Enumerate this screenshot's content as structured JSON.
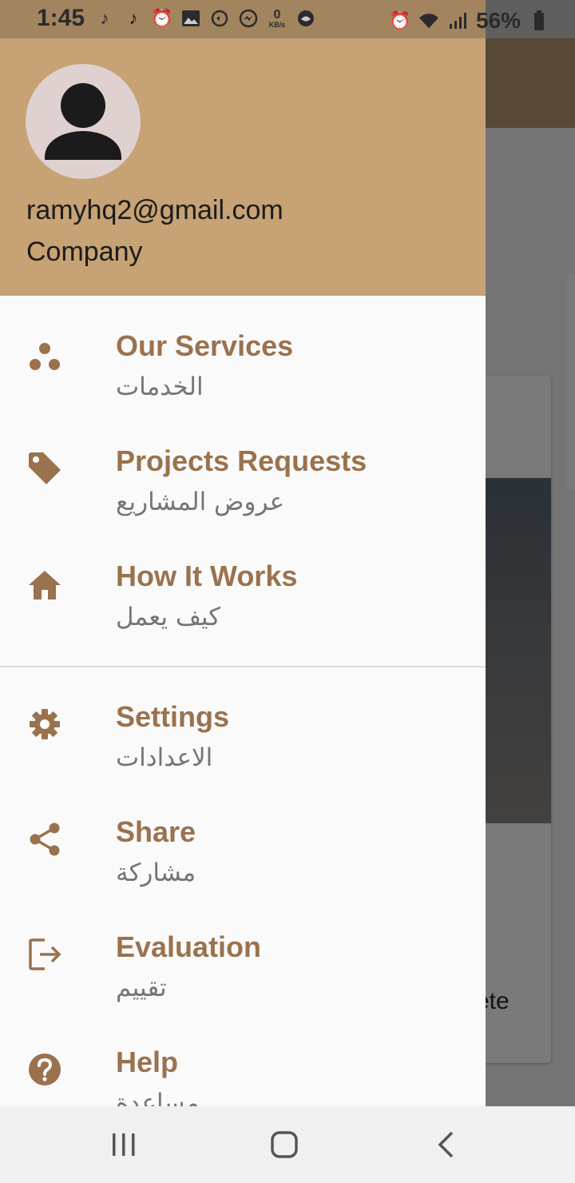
{
  "status_bar": {
    "time": "1:45",
    "network_speed_value": "0",
    "network_speed_unit": "KB/s",
    "battery": "56%"
  },
  "background_app": {
    "visible_text": "ete"
  },
  "drawer": {
    "header": {
      "email": "ramyhq2@gmail.com",
      "account_type": "Company"
    },
    "items": [
      {
        "icon": "services-icon",
        "title": "Our Services",
        "subtitle": "الخدمات"
      },
      {
        "icon": "tag-icon",
        "title": "Projects Requests",
        "subtitle": "عروض المشاريع"
      },
      {
        "icon": "home-icon",
        "title": "How It Works",
        "subtitle": "كيف يعمل"
      },
      {
        "icon": "gear-icon",
        "title": "Settings",
        "subtitle": "الاعدادات"
      },
      {
        "icon": "share-icon",
        "title": "Share",
        "subtitle": "مشاركة"
      },
      {
        "icon": "exit-icon",
        "title": "Evaluation",
        "subtitle": "تقييم"
      },
      {
        "icon": "help-icon",
        "title": "Help",
        "subtitle": "مساعدة"
      }
    ]
  },
  "colors": {
    "header_bg": "#c6a274",
    "accent": "#9a724e",
    "subtitle": "#757575",
    "drawer_bg": "#fafafa"
  }
}
